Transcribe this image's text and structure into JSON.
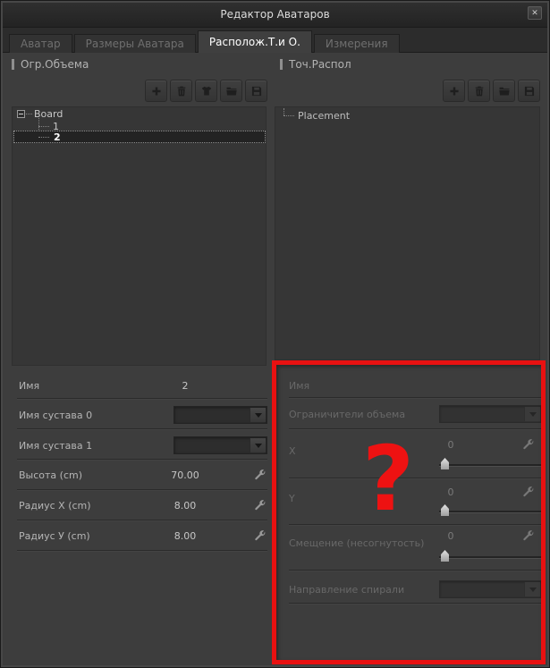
{
  "window": {
    "title": "Редактор Аватаров",
    "close_icon": "✕"
  },
  "tabs": [
    {
      "label": "Аватар",
      "active": false
    },
    {
      "label": "Размеры Аватара",
      "active": false
    },
    {
      "label": "Располож.Т.и О.",
      "active": true
    },
    {
      "label": "Измерения",
      "active": false
    }
  ],
  "left": {
    "header": "Огр.Объема",
    "toolbar_icons": [
      "add-icon",
      "trash-icon",
      "garment-icon",
      "open-folder-icon",
      "save-icon"
    ],
    "tree": {
      "root": "Board",
      "items": [
        {
          "label": "1",
          "selected": false
        },
        {
          "label": "2",
          "selected": true
        }
      ]
    },
    "rows": [
      {
        "label": "Имя",
        "type": "value",
        "value": "2"
      },
      {
        "label": "Имя сустава 0",
        "type": "dropdown",
        "value": ""
      },
      {
        "label": "Имя сустава 1",
        "type": "dropdown",
        "value": ""
      },
      {
        "label": "Высота (cm)",
        "type": "value_wrench",
        "value": "70.00"
      },
      {
        "label": "Радиус X (cm)",
        "type": "value_wrench",
        "value": "8.00"
      },
      {
        "label": "Радиус У (cm)",
        "type": "value_wrench",
        "value": "8.00"
      }
    ]
  },
  "right": {
    "header": "Точ.Распол",
    "toolbar_icons": [
      "add-icon",
      "trash-icon",
      "open-folder-icon",
      "save-icon"
    ],
    "list": {
      "items": [
        "Placement"
      ]
    },
    "disabled": true,
    "rows": [
      {
        "label": "Имя",
        "type": "text",
        "value": ""
      },
      {
        "label": "Ограничители объема",
        "type": "dropdown",
        "value": ""
      },
      {
        "label": "X",
        "type": "slider",
        "value": "0"
      },
      {
        "label": "Y",
        "type": "slider",
        "value": "0"
      },
      {
        "label": "Смещение (несогнутость)",
        "type": "slider",
        "value": "0"
      },
      {
        "label": "Направление спирали",
        "type": "dropdown",
        "value": ""
      }
    ]
  },
  "annotation": {
    "glyph": "?",
    "color": "#ee1111"
  }
}
